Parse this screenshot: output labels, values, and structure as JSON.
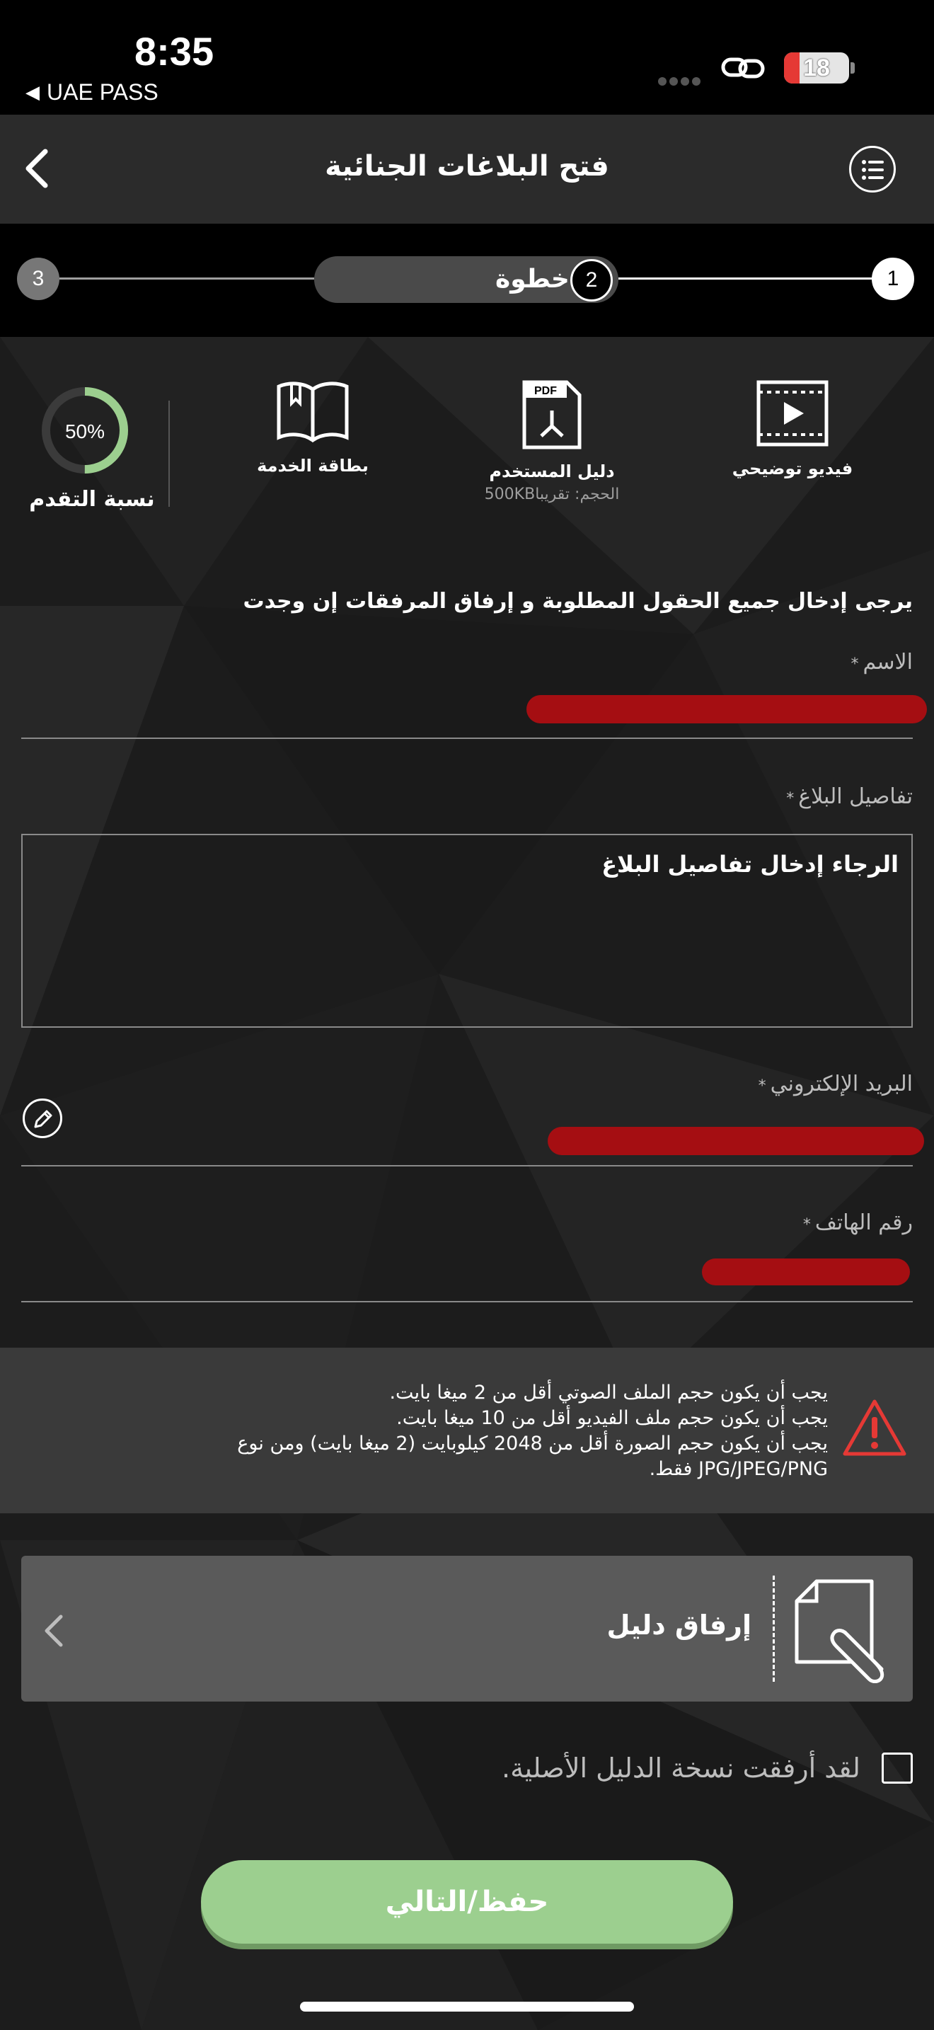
{
  "status_bar": {
    "time": "8:35",
    "back_app": "UAE PASS",
    "battery": "18"
  },
  "header": {
    "title": "فتح البلاغات الجنائية"
  },
  "stepper": {
    "step1": "1",
    "step2": "2",
    "step3": "3",
    "current_label": "خطوة",
    "current_step": 2,
    "total_steps": 3
  },
  "quick_links": {
    "video": "فيديو توضيحي",
    "guide": "دليل المستخدم",
    "guide_size": "الحجم: تقريبا500KB",
    "card": "بطاقة الخدمة",
    "progress_value": "50%",
    "progress_fraction": 0.5,
    "progress_label": "نسبة التقدم"
  },
  "form": {
    "intro": "يرجى إدخال جميع الحقول المطلوبة و إرفاق المرفقات إن وجدت",
    "required_mark": "*",
    "name_label": "الاسم",
    "details_label": "تفاصيل البلاغ",
    "details_placeholder": "الرجاء إدخال تفاصيل البلاغ",
    "email_label": "البريد الإلكتروني",
    "phone_label": "رقم الهاتف"
  },
  "warning": {
    "line1": "يجب أن يكون حجم الملف الصوتي أقل من 2 ميغا بايت.",
    "line2": "يجب أن يكون حجم ملف الفيديو أقل من 10 ميغا بايت.",
    "line3": "يجب أن يكون حجم الصورة أقل من 2048 كيلوبايت (2 ميغا بايت) ومن نوع JPG/JPEG/PNG فقط."
  },
  "attach": {
    "label": "إرفاق دليل"
  },
  "checkbox": {
    "label": "لقد أرفقت نسخة الدليل الأصلية."
  },
  "button": {
    "next": "حفظ/التالي"
  },
  "colors": {
    "accent_green": "#9ccf8f",
    "redaction": "#a50e12",
    "warning_red": "#e53935"
  }
}
